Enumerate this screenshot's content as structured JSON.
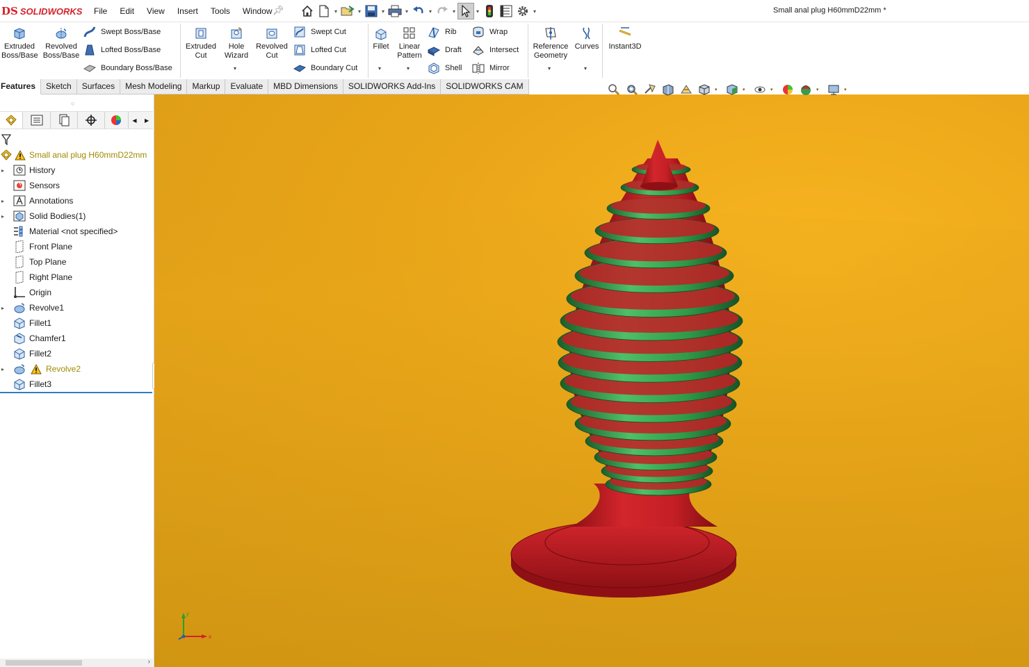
{
  "app": {
    "logo_mark": "DS",
    "logo_text": "SOLIDWORKS",
    "document_title": "Small anal plug  H60mmD22mm *"
  },
  "menu": [
    "File",
    "Edit",
    "View",
    "Insert",
    "Tools",
    "Window"
  ],
  "quick_access": [
    "home-icon",
    "new-document-icon",
    "open-icon",
    "save-icon",
    "print-icon",
    "undo-icon",
    "redo-icon",
    "select-icon",
    "rebuild-icon",
    "file-properties-icon",
    "options-icon"
  ],
  "command_manager": {
    "extruded_boss": "Extruded\nBoss/Base",
    "revolved_boss": "Revolved\nBoss/Base",
    "swept_boss": "Swept Boss/Base",
    "lofted_boss": "Lofted Boss/Base",
    "boundary_boss": "Boundary Boss/Base",
    "extruded_cut": "Extruded\nCut",
    "hole_wizard": "Hole\nWizard",
    "revolved_cut": "Revolved\nCut",
    "swept_cut": "Swept Cut",
    "lofted_cut": "Lofted Cut",
    "boundary_cut": "Boundary Cut",
    "fillet": "Fillet",
    "linear_pattern": "Linear\nPattern",
    "rib": "Rib",
    "draft": "Draft",
    "shell": "Shell",
    "wrap": "Wrap",
    "intersect": "Intersect",
    "mirror": "Mirror",
    "reference_geometry": "Reference\nGeometry",
    "curves": "Curves",
    "instant3d": "Instant3D"
  },
  "tabs": [
    "Features",
    "Sketch",
    "Surfaces",
    "Mesh Modeling",
    "Markup",
    "Evaluate",
    "MBD Dimensions",
    "SOLIDWORKS Add-Ins",
    "SOLIDWORKS CAM"
  ],
  "active_tab": "Features",
  "feature_tree": {
    "root": "Small anal plug  H60mmD22mm",
    "items": [
      {
        "label": "History",
        "icon": "history-icon"
      },
      {
        "label": "Sensors",
        "icon": "sensors-icon"
      },
      {
        "label": "Annotations",
        "icon": "annotations-icon"
      },
      {
        "label": "Solid Bodies(1)",
        "icon": "solid-bodies-icon"
      },
      {
        "label": "Material <not specified>",
        "icon": "material-icon"
      },
      {
        "label": "Front Plane",
        "icon": "plane-icon"
      },
      {
        "label": "Top Plane",
        "icon": "plane-icon"
      },
      {
        "label": "Right Plane",
        "icon": "plane-icon"
      },
      {
        "label": "Origin",
        "icon": "origin-icon"
      },
      {
        "label": "Revolve1",
        "icon": "revolve-icon"
      },
      {
        "label": "Fillet1",
        "icon": "fillet-icon"
      },
      {
        "label": "Chamfer1",
        "icon": "chamfer-icon"
      },
      {
        "label": "Fillet2",
        "icon": "fillet-icon"
      },
      {
        "label": "Revolve2",
        "icon": "revolve-icon",
        "warning": true
      },
      {
        "label": "Fillet3",
        "icon": "fillet-icon"
      }
    ]
  },
  "triad_labels": {
    "x": "x",
    "y": "y"
  },
  "colors": {
    "viewport_background": "#e9a518",
    "model_red": "#c41f25",
    "model_green": "#2f9a48",
    "warning_text": "#a08a00",
    "brand_red": "#d3222a"
  }
}
